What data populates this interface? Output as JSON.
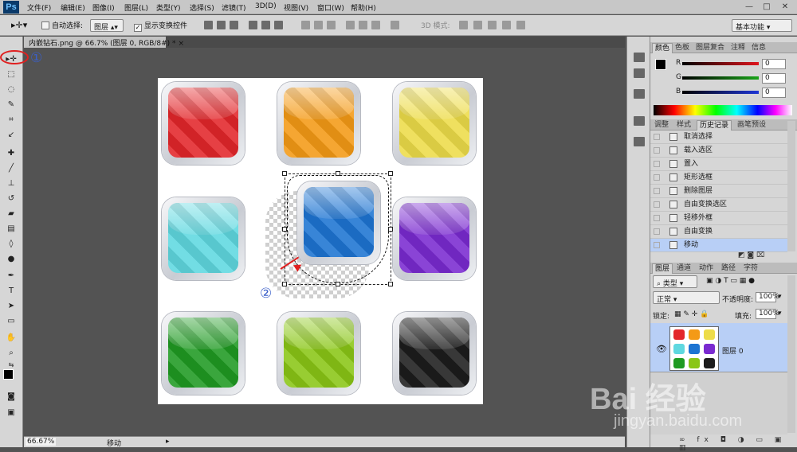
{
  "app": {
    "logo": "Ps"
  },
  "menu": [
    "文件(F)",
    "编辑(E)",
    "图像(I)",
    "图层(L)",
    "类型(Y)",
    "选择(S)",
    "滤镜(T)",
    "3D(D)",
    "视图(V)",
    "窗口(W)",
    "帮助(H)"
  ],
  "window_controls": [
    "—",
    "□",
    "✕"
  ],
  "options": {
    "auto_select_label": "自动选择:",
    "auto_select_value": "图层",
    "show_transform_label": "显示变换控件",
    "mode_3d_label": "3D 模式:",
    "workspace": "基本功能"
  },
  "document": {
    "tab_title": "内嵌钻石.png @ 66.7% (图层 0, RGB/8#) *",
    "close_glyph": "×"
  },
  "annotations": {
    "callout1": "①",
    "callout2": "②"
  },
  "status": {
    "zoom": "66.67%",
    "info": "移动"
  },
  "panels": {
    "color_tabs": [
      "颜色",
      "色板",
      "图层复合",
      "注释",
      "信息"
    ],
    "color_values": [
      {
        "channel": "R",
        "value": "0",
        "color": "#e0141c"
      },
      {
        "channel": "G",
        "value": "0",
        "color": "#1aa51a"
      },
      {
        "channel": "B",
        "value": "0",
        "color": "#1f36d6"
      }
    ],
    "history_tabs": [
      "调整",
      "样式",
      "历史记录",
      "画笔预设"
    ],
    "history_items": [
      "取消选择",
      "载入选区",
      "置入",
      "矩形选框",
      "删除图层",
      "自由变换选区",
      "轻移外框",
      "自由变换",
      "移动"
    ],
    "layers_tabs": [
      "图层",
      "通道",
      "动作",
      "路径",
      "字符"
    ],
    "layer_filter": "类型",
    "blend_mode": "正常",
    "opacity_label": "不透明度:",
    "opacity_value": "100%",
    "lock_label": "锁定:",
    "fill_label": "填充:",
    "fill_value": "100%",
    "layer_name": "图层 0",
    "bottom_icons": "∞ fx ◘ ◑ ▭ ▣ ▥"
  },
  "icons": [
    {
      "name": "red",
      "color": "#e3262a"
    },
    {
      "name": "orange",
      "color": "#f49a16"
    },
    {
      "name": "yellow",
      "color": "#eddc49"
    },
    {
      "name": "cyan",
      "color": "#5fd8e0"
    },
    {
      "name": "blue",
      "color": "#1d74d2"
    },
    {
      "name": "purple",
      "color": "#7a2ad0"
    },
    {
      "name": "green",
      "color": "#1f9a22"
    },
    {
      "name": "lime",
      "color": "#8ac616"
    },
    {
      "name": "black",
      "color": "#1c1c1c"
    }
  ],
  "watermark": {
    "brand": "Bai 经验",
    "url": "jingyan.baidu.com"
  }
}
